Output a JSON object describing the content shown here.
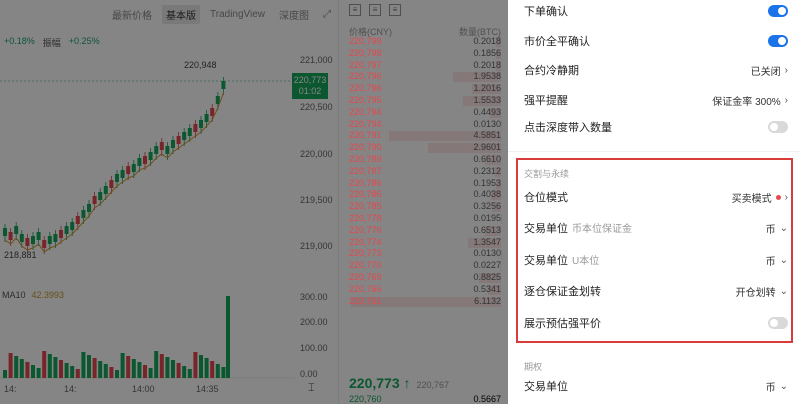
{
  "chart": {
    "tabs": [
      "最新价格",
      "基本版",
      "TradingView",
      "深度图"
    ],
    "active_tab": 1,
    "indicators": [
      "+0.18%",
      "振幅",
      "+0.25%"
    ],
    "vol_label": "MA10",
    "vol_value": "42.3993",
    "y_labels": [
      "221,000",
      "220,500",
      "220,000",
      "219,500",
      "219,000"
    ],
    "vol_axis": [
      "300.00",
      "200.00",
      "100.00",
      "0.00"
    ],
    "x_labels": [
      "14:",
      "14:",
      "14:00",
      "14:35"
    ],
    "peak": "220,948",
    "low": "218,881",
    "current_price": "220,773",
    "current_time": "01:02"
  },
  "orderbook": {
    "header_price": "价格(CNY)",
    "header_qty": "数量(BTC)",
    "rows": [
      {
        "p": "220,799",
        "q": "0.2018"
      },
      {
        "p": "220,798",
        "q": "0.1856"
      },
      {
        "p": "220,797",
        "q": "0.2018"
      },
      {
        "p": "220,796",
        "q": "1.9538"
      },
      {
        "p": "220,796",
        "q": "1.2016"
      },
      {
        "p": "220,795",
        "q": "1.5533"
      },
      {
        "p": "220,794",
        "q": "0.4493"
      },
      {
        "p": "220,794",
        "q": "0.0130"
      },
      {
        "p": "220,791",
        "q": "4.5851"
      },
      {
        "p": "220,790",
        "q": "2.9601"
      },
      {
        "p": "220,789",
        "q": "0.6610"
      },
      {
        "p": "220,787",
        "q": "0.2312"
      },
      {
        "p": "220,786",
        "q": "0.1953"
      },
      {
        "p": "220,786",
        "q": "0.4038"
      },
      {
        "p": "220,785",
        "q": "0.3256"
      },
      {
        "p": "220,778",
        "q": "0.0195"
      },
      {
        "p": "220,776",
        "q": "0.6513"
      },
      {
        "p": "220,774",
        "q": "1.3547"
      },
      {
        "p": "220,773",
        "q": "0.0130"
      },
      {
        "p": "220,770",
        "q": "0.0227"
      },
      {
        "p": "220,769",
        "q": "0.8825"
      },
      {
        "p": "220,766",
        "q": "0.5341"
      },
      {
        "p": "220,761",
        "q": "6.1132"
      }
    ],
    "last_price": "220,773 ↑",
    "last_sub": "220,767",
    "after_price": "220,760",
    "after_qty": "0.5667"
  },
  "settings": {
    "order_confirm": "下单确认",
    "market_close_confirm": "市价全平确认",
    "cooling": "合约冷静期",
    "cooling_val": "已关闭",
    "liquidation_alert": "强平提醒",
    "liquidation_val": "保证金率 300%",
    "depth_click": "点击深度带入数量",
    "section_delivery": "交割与永续",
    "position_mode": "仓位模式",
    "position_mode_val": "买卖模式",
    "trade_unit": "交易单位",
    "trade_unit_sub1": "币本位保证金",
    "coin": "币",
    "trade_unit_sub2": "U本位",
    "isolated_transfer": "逐仓保证金划转",
    "isolated_transfer_val": "开仓划转",
    "show_est_liq": "展示预估强平价",
    "section_options": "期权",
    "options_unit": "交易单位"
  }
}
